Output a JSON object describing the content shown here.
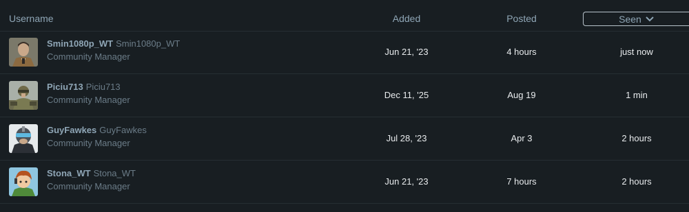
{
  "header": {
    "username": "Username",
    "added": "Added",
    "posted": "Posted",
    "seen": "Seen"
  },
  "rows": [
    {
      "username": "Smin1080p_WT",
      "name": "Smin1080p_WT",
      "title": "Community Manager",
      "added": "Jun 21, '23",
      "posted": "4 hours",
      "seen": "just now"
    },
    {
      "username": "Piciu713",
      "name": "Piciu713",
      "title": "Community Manager",
      "added": "Dec 11, '25",
      "posted": "Aug 19",
      "seen": "1 min"
    },
    {
      "username": "GuyFawkes",
      "name": "GuyFawkes",
      "title": "Community Manager",
      "added": "Jul 28, '23",
      "posted": "Apr 3",
      "seen": "2 hours"
    },
    {
      "username": "Stona_WT",
      "name": "Stona_WT",
      "title": "Community Manager",
      "added": "Jun 21, '23",
      "posted": "7 hours",
      "seen": "2 hours"
    }
  ]
}
